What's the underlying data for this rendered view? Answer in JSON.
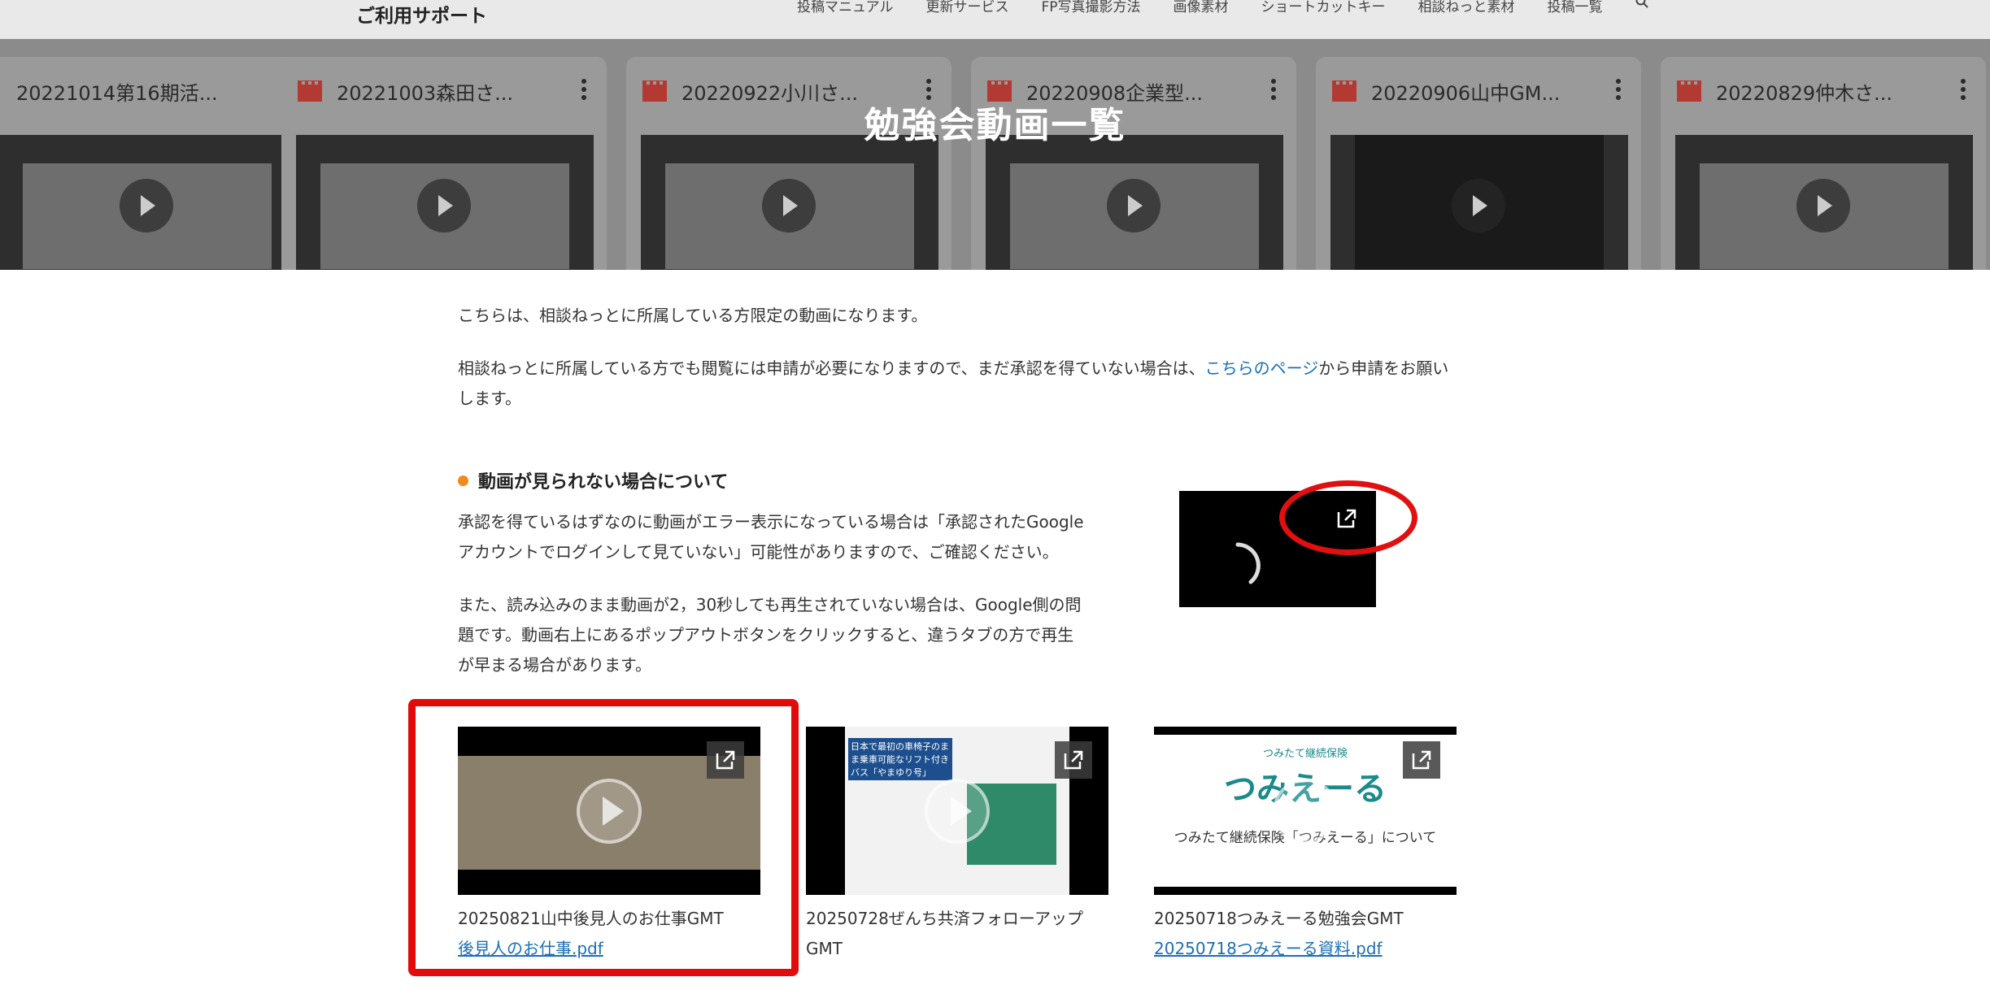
{
  "header": {
    "brand": "ご利用サポート",
    "nav": [
      "投稿マニュアル",
      "更新サービス",
      "FP写真撮影方法",
      "画像素材",
      "ショートカットキー",
      "相談ねっと素材",
      "投稿一覧"
    ]
  },
  "hero": {
    "title": "勉強会動画一覧",
    "cards": [
      {
        "title": "20221014第16期活..."
      },
      {
        "title": "20221003森田さ..."
      },
      {
        "title": "20220922小川さ..."
      },
      {
        "title": "20220908企業型..."
      },
      {
        "title": "20220906山中GM..."
      },
      {
        "title": "20220829仲木さ..."
      }
    ]
  },
  "intro": {
    "line1": "こちらは、相談ねっとに所属している方限定の動画になります。",
    "line2_before": "相談ねっとに所属している方でも閲覧には申請が必要になりますので、まだ承認を得ていない場合は、",
    "line2_link": "こちらのページ",
    "line2_after": "から申請をお願い",
    "line2_cont": "します。"
  },
  "notice": {
    "heading": "動画が見られない場合について",
    "para1_l1": "承認を得ているはずなのに動画がエラー表示になっている場合は「承認されたGoogle",
    "para1_l2": "アカウントでログインして見ていない」可能性がありますので、ご確認ください。",
    "para2_l1": "また、読み込みのまま動画が2，30秒しても再生されていない場合は、Google側の問",
    "para2_l2": "題です。動画右上にあるポップアウトボタンをクリックすると、違うタブの方で再生",
    "para2_l3": "が早まる場合があります。"
  },
  "videos": [
    {
      "title": "20250821山中後見人のお仕事GMT",
      "link": "後見人のお仕事.pdf"
    },
    {
      "title": "20250728ぜんち共済フォローアップ",
      "title2": "GMT",
      "link": ""
    },
    {
      "title": "20250718つみえーる勉強会GMT",
      "link": "20250718つみえーる資料.pdf"
    }
  ],
  "thumb3": {
    "caption_top": "つみたて継続保険",
    "logo": "つみえーる",
    "sub": "つみたて継続保険「つみえーる」について"
  },
  "thumb2": {
    "headline": "日本で最初の車椅子のまま乗車可能なリフト付きバス「やまゆり号」"
  },
  "colors": {
    "accent_red": "#e30a0a",
    "link": "#1a6fb5",
    "bullet": "#f08a1c"
  }
}
